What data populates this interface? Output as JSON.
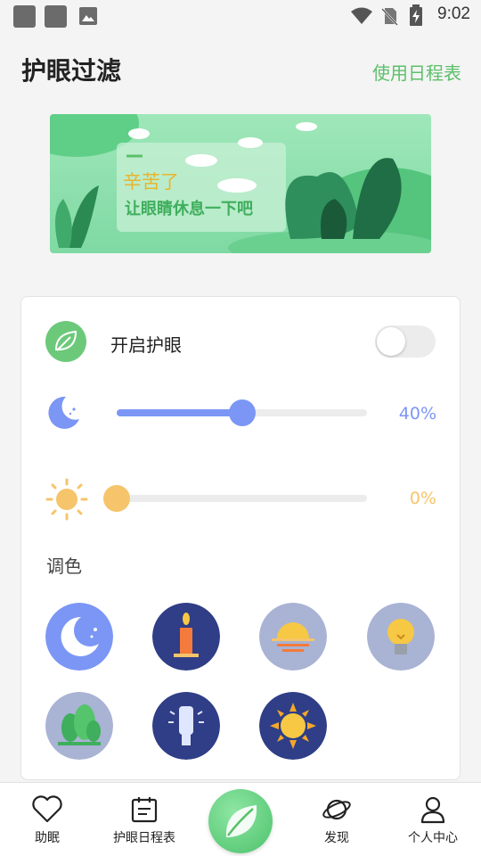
{
  "status_bar": {
    "time": "9:02"
  },
  "header": {
    "title": "护眼过滤",
    "schedule_link": "使用日程表"
  },
  "banner": {
    "line1": "辛苦了",
    "line2": "让眼睛休息一下吧"
  },
  "settings": {
    "toggle_label": "开启护眼",
    "toggle_on": false,
    "filter_level": {
      "value": "40%",
      "fraction": 0.5
    },
    "brightness_level": {
      "value": "0%",
      "fraction": 0.0
    },
    "color_label": "调色"
  },
  "colors": {
    "accent_green": "#5cc06a",
    "slider_blue": "#7b96f5",
    "slider_orange": "#f6c46b"
  },
  "tabs": [
    {
      "label": "助眠",
      "icon": "heart-icon"
    },
    {
      "label": "护眼日程表",
      "icon": "calendar-icon"
    },
    {
      "label": "",
      "icon": "leaf-icon"
    },
    {
      "label": "发现",
      "icon": "planet-icon"
    },
    {
      "label": "个人中心",
      "icon": "person-icon"
    }
  ]
}
